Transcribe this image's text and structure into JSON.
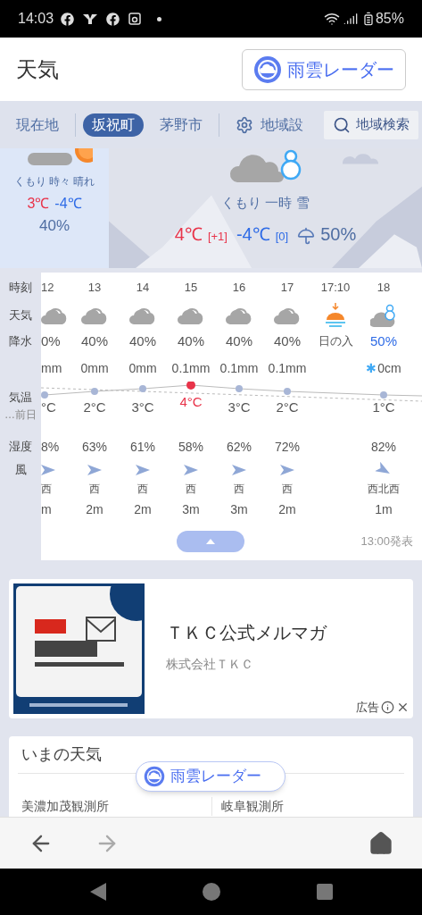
{
  "status_bar": {
    "time": "14:03",
    "battery": "85%"
  },
  "header": {
    "title": "天気",
    "radar_button": "雨雲レーダー"
  },
  "location_tabs": [
    {
      "label": "現在地",
      "selected": false
    },
    {
      "label": "坂祝町",
      "selected": true
    },
    {
      "label": "茅野市",
      "selected": false
    }
  ],
  "region_settings": "地域設",
  "region_search": "地域検索",
  "today": {
    "weather": "くもり 時々 晴れ",
    "high": "3℃",
    "low": "-4℃",
    "precip": "40%"
  },
  "tomorrow": {
    "weather": "くもり 一時 雪",
    "high": "4℃",
    "high_diff": "[+1]",
    "low": "-4℃",
    "low_diff": "[0]",
    "precip": "50%"
  },
  "hourly": {
    "labels": {
      "time": "時刻",
      "weather": "天気",
      "precip": "降水",
      "temp": "気温",
      "prev_day": "…前日",
      "humidity": "湿度",
      "wind": "風"
    },
    "hours": [
      {
        "time": "12",
        "kind": "cloudy",
        "precip": "0%",
        "amount": "mm",
        "temp": "°C",
        "humidity": "8%",
        "wind_diagonal": false,
        "wind_dir": "西",
        "wind_speed": "m",
        "highlight": false,
        "snow": false
      },
      {
        "time": "13",
        "kind": "cloudy",
        "precip": "40%",
        "amount": "0mm",
        "temp": "2°C",
        "humidity": "63%",
        "wind_diagonal": false,
        "wind_dir": "西",
        "wind_speed": "2m",
        "highlight": false,
        "snow": false
      },
      {
        "time": "14",
        "kind": "cloudy",
        "precip": "40%",
        "amount": "0mm",
        "temp": "3°C",
        "humidity": "61%",
        "wind_diagonal": false,
        "wind_dir": "西",
        "wind_speed": "2m",
        "highlight": false,
        "snow": false
      },
      {
        "time": "15",
        "kind": "cloudy",
        "precip": "40%",
        "amount": "0.1mm",
        "temp": "4°C",
        "humidity": "58%",
        "wind_diagonal": false,
        "wind_dir": "西",
        "wind_speed": "3m",
        "highlight": true,
        "snow": false
      },
      {
        "time": "16",
        "kind": "cloudy",
        "precip": "40%",
        "amount": "0.1mm",
        "temp": "3°C",
        "humidity": "62%",
        "wind_diagonal": false,
        "wind_dir": "西",
        "wind_speed": "3m",
        "highlight": false,
        "snow": false
      },
      {
        "time": "17",
        "kind": "cloudy",
        "precip": "40%",
        "amount": "0.1mm",
        "temp": "2°C",
        "humidity": "72%",
        "wind_diagonal": false,
        "wind_dir": "西",
        "wind_speed": "2m",
        "highlight": false,
        "snow": false
      },
      {
        "time": "17:10",
        "kind": "sunset",
        "precip": "日の入",
        "snow": false
      },
      {
        "time": "18",
        "kind": "cloud_snow",
        "precip": "50%",
        "amount": "0cm",
        "snow_mark": "✱",
        "temp": "1°C",
        "humidity": "82%",
        "wind_diagonal": true,
        "wind_dir": "西北西",
        "wind_speed": "1m",
        "highlight": false,
        "snow": true
      }
    ],
    "issued": "13:00発表"
  },
  "ad": {
    "title": "ＴＫＣ公式メルマガ",
    "advertiser": "株式会社ＴＫＣ",
    "label": "広告"
  },
  "current_weather": {
    "title": "いまの天気",
    "stations": [
      "美濃加茂観測所",
      "岐阜観測所"
    ]
  },
  "floating_radar": "雨雲レーダー"
}
